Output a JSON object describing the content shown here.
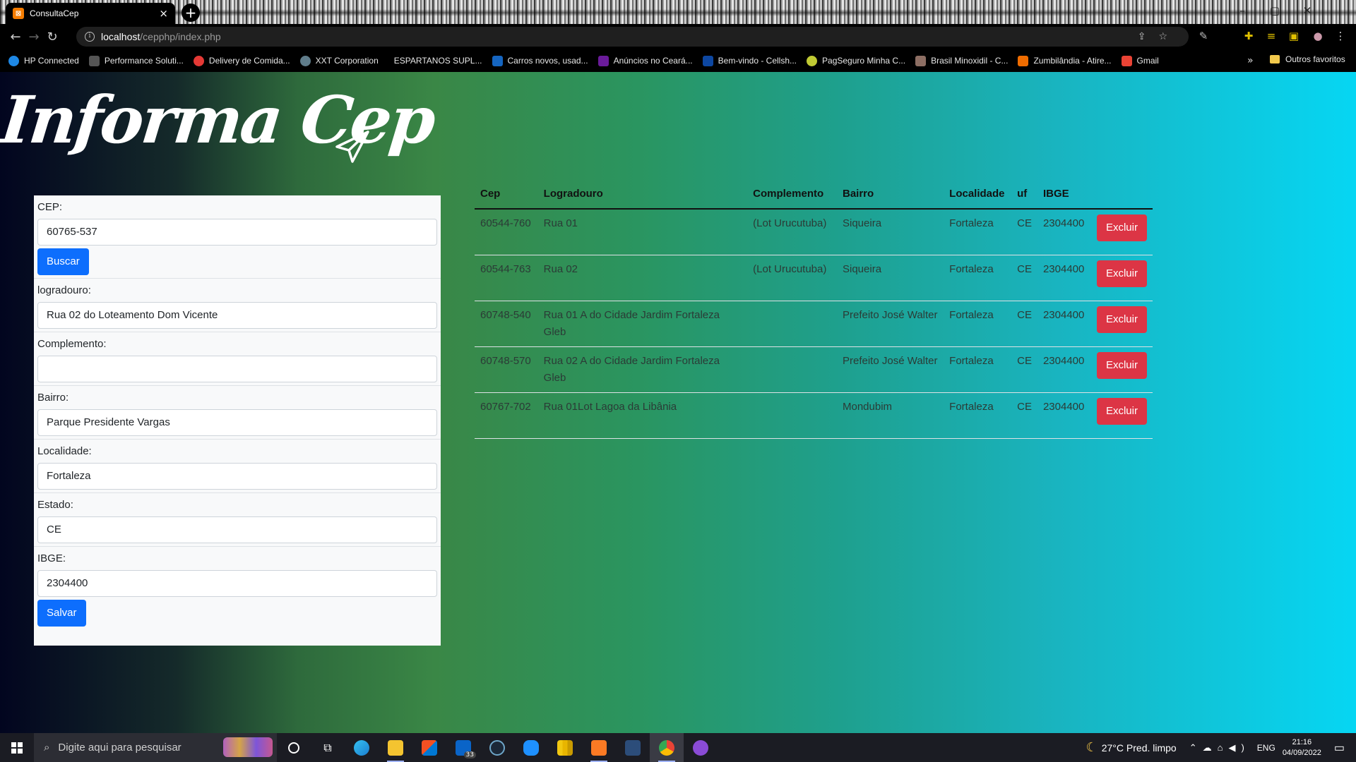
{
  "browser": {
    "tab_title": "ConsultaCep",
    "tab_favicon": "XAMPP",
    "url_host": "localhost",
    "url_path": "/cepphp/index.php",
    "bookmarks": [
      {
        "label": "HP Connected",
        "color": "#1e88e5"
      },
      {
        "label": "Performance Soluti...",
        "color": "#444444"
      },
      {
        "label": "Delivery de Comida...",
        "color": "#e53935"
      },
      {
        "label": "XXT Corporation",
        "color": "#607d8b"
      },
      {
        "label": "ESPARTANOS SUPL...",
        "color": "#000000"
      },
      {
        "label": "Carros novos, usad...",
        "color": "#1565c0"
      },
      {
        "label": "Anúncios no Ceará...",
        "color": "#6a1b9a"
      },
      {
        "label": "Bem-vindo - Cellsh...",
        "color": "#0d47a1"
      },
      {
        "label": "PagSeguro Minha C...",
        "color": "#c0ca33"
      },
      {
        "label": "Brasil Minoxidil - C...",
        "color": "#8d6e63"
      },
      {
        "label": "Zumbilândia - Atire...",
        "color": "#ef6c00"
      },
      {
        "label": "Gmail",
        "color": "#ea4335"
      }
    ],
    "bookmarks_more": "»",
    "other_bookmarks": "Outros favoritos"
  },
  "page": {
    "logo_text": "Informa Cep",
    "form": {
      "cep_label": "CEP:",
      "cep_value": "60765-537",
      "buscar_label": "Buscar",
      "logradouro_label": "logradouro:",
      "logradouro_value": "Rua 02 do Loteamento Dom Vicente",
      "complemento_label": "Complemento:",
      "complemento_value": "",
      "bairro_label": "Bairro:",
      "bairro_value": "Parque Presidente Vargas",
      "localidade_label": "Localidade:",
      "localidade_value": "Fortaleza",
      "estado_label": "Estado:",
      "estado_value": "CE",
      "ibge_label": "IBGE:",
      "ibge_value": "2304400",
      "salvar_label": "Salvar"
    },
    "table": {
      "headers": {
        "cep": "Cep",
        "logradouro": "Logradouro",
        "complemento": "Complemento",
        "bairro": "Bairro",
        "localidade": "Localidade",
        "uf": "uf",
        "ibge": "IBGE"
      },
      "delete_label": "Excluir",
      "rows": [
        {
          "cep": "60544-760",
          "logradouro": "Rua 01",
          "complemento": "(Lot Urucutuba)",
          "bairro": "Siqueira",
          "localidade": "Fortaleza",
          "uf": "CE",
          "ibge": "2304400"
        },
        {
          "cep": "60544-763",
          "logradouro": "Rua 02",
          "complemento": "(Lot Urucutuba)",
          "bairro": "Siqueira",
          "localidade": "Fortaleza",
          "uf": "CE",
          "ibge": "2304400"
        },
        {
          "cep": "60748-540",
          "logradouro": "Rua 01 A do Cidade Jardim Fortaleza Gleb",
          "complemento": "",
          "bairro": "Prefeito José Walter",
          "localidade": "Fortaleza",
          "uf": "CE",
          "ibge": "2304400"
        },
        {
          "cep": "60748-570",
          "logradouro": "Rua 02 A do Cidade Jardim Fortaleza Gleb",
          "complemento": "",
          "bairro": "Prefeito José Walter",
          "localidade": "Fortaleza",
          "uf": "CE",
          "ibge": "2304400"
        },
        {
          "cep": "60767-702",
          "logradouro": "Rua 01Lot Lagoa da Libânia",
          "complemento": "",
          "bairro": "Mondubim",
          "localidade": "Fortaleza",
          "uf": "CE",
          "ibge": "2304400"
        }
      ]
    }
  },
  "taskbar": {
    "search_placeholder": "Digite aqui para pesquisar",
    "mail_badge": "33",
    "weather": "27°C  Pred. limpo",
    "language": "ENG",
    "time": "21:16",
    "date": "04/09/2022"
  },
  "colors": {
    "primary": "#0d6efd",
    "danger": "#dc3545"
  }
}
